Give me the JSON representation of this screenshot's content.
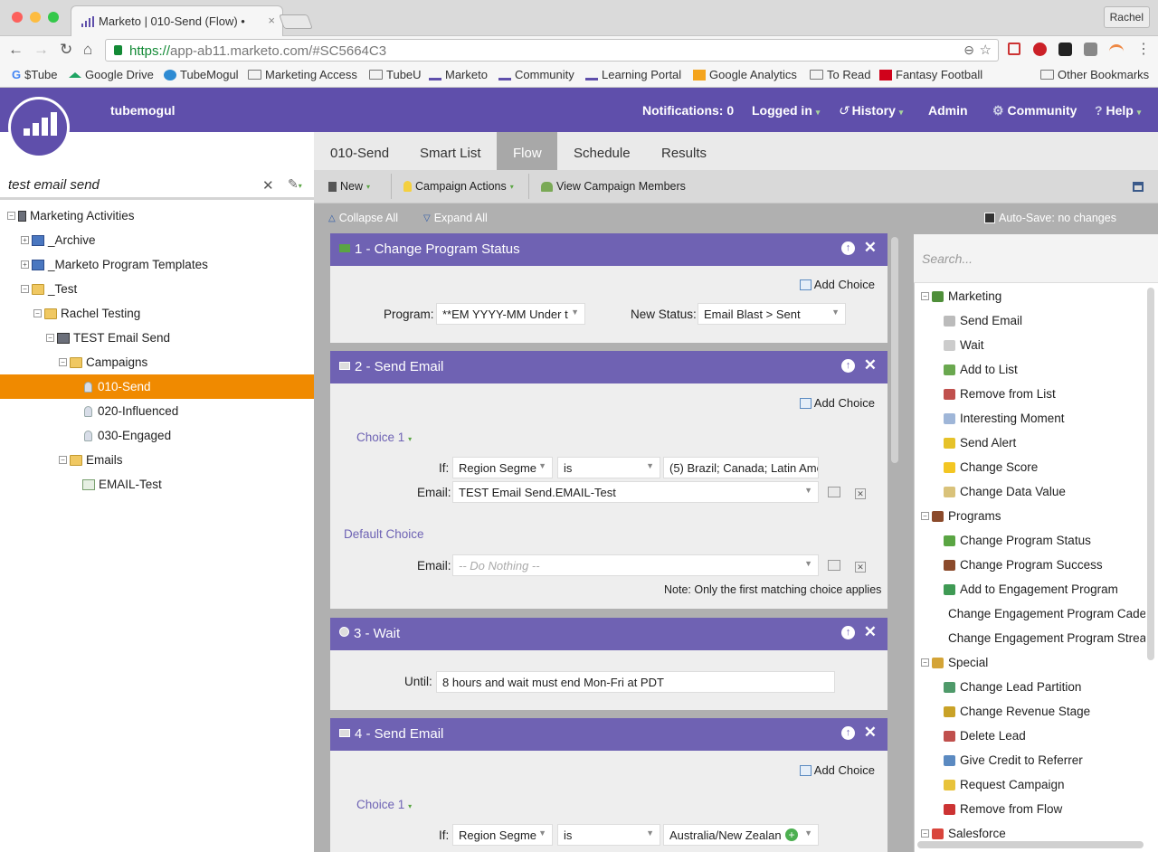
{
  "browser": {
    "tab_title": "Marketo | 010-Send (Flow) •",
    "tab_close": "×",
    "profile": "Rachel",
    "url_https": "https://",
    "url_rest": "app-ab11.marketo.com/#SC5664C3",
    "bookmarks": [
      "$Tube",
      "Google Drive",
      "TubeMogul",
      "Marketing Access",
      "TubeU",
      "Marketo",
      "Community",
      "Learning Portal",
      "Google Analytics",
      "To Read",
      "Fantasy Football"
    ],
    "other_bookmarks": "Other Bookmarks"
  },
  "header": {
    "workspace": "tubemogul",
    "notifications": "Notifications: 0",
    "logged_in": "Logged in",
    "history": "History",
    "admin": "Admin",
    "community": "Community",
    "help": "Help"
  },
  "left": {
    "search_value": "test email send",
    "clear": "✕",
    "tree": [
      {
        "label": "Marketing Activities"
      },
      {
        "label": "_Archive"
      },
      {
        "label": "_Marketo Program Templates"
      },
      {
        "label": "_Test"
      },
      {
        "label": "Rachel Testing"
      },
      {
        "label": "TEST Email Send"
      },
      {
        "label": "Campaigns"
      },
      {
        "label": "010-Send"
      },
      {
        "label": "020-Influenced"
      },
      {
        "label": "030-Engaged"
      },
      {
        "label": "Emails"
      },
      {
        "label": "EMAIL-Test"
      }
    ]
  },
  "tabs": [
    "010-Send",
    "Smart List",
    "Flow",
    "Schedule",
    "Results"
  ],
  "actions": {
    "new": "New",
    "campaign_actions": "Campaign Actions",
    "view_members": "View Campaign Members",
    "collapse_all": "Collapse All",
    "expand_all": "Expand All",
    "autosave": "Auto-Save: no changes"
  },
  "flow": {
    "add_choice": "Add Choice",
    "step1": {
      "title": "1 - Change Program Status",
      "program_label": "Program:",
      "program_value": "**EM YYYY-MM Under t",
      "status_label": "New Status:",
      "status_value": "Email Blast > Sent"
    },
    "step2": {
      "title": "2 - Send Email",
      "choice1": "Choice 1",
      "if_label": "If:",
      "if_field": "Region Segme",
      "if_op": "is",
      "if_value": "(5) Brazil; Canada; Latin Ame",
      "email_label": "Email:",
      "email_value": "TEST Email Send.EMAIL-Test",
      "default_choice": "Default Choice",
      "default_email_label": "Email:",
      "default_email_value": "-- Do Nothing --",
      "note": "Note: Only the first matching choice applies"
    },
    "step3": {
      "title": "3 - Wait",
      "until_label": "Until:",
      "until_value": "8 hours and wait must end Mon-Fri at  PDT"
    },
    "step4": {
      "title": "4 - Send Email",
      "choice1": "Choice 1",
      "if_label": "If:",
      "if_field": "Region Segme",
      "if_op": "is",
      "if_value": "Australia/New Zealan"
    }
  },
  "right": {
    "search_placeholder": "Search...",
    "items": [
      {
        "label": "Marketing",
        "group": true,
        "color": "#4f8f3a"
      },
      {
        "label": "Send Email",
        "color": "#bbbbbb"
      },
      {
        "label": "Wait",
        "color": "#cccccc"
      },
      {
        "label": "Add to List",
        "color": "#6aa84f"
      },
      {
        "label": "Remove from List",
        "color": "#c0504d"
      },
      {
        "label": "Interesting Moment",
        "color": "#9fb6d8"
      },
      {
        "label": "Send Alert",
        "color": "#e6c229"
      },
      {
        "label": "Change Score",
        "color": "#f3c623"
      },
      {
        "label": "Change Data Value",
        "color": "#d9c27a"
      },
      {
        "label": "Programs",
        "group": true,
        "color": "#8b4a2b"
      },
      {
        "label": "Change Program Status",
        "color": "#5aa543"
      },
      {
        "label": "Change Program Success",
        "color": "#8b4a2b"
      },
      {
        "label": "Add to Engagement Program",
        "color": "#3f9a54"
      },
      {
        "label": "Change Engagement Program Cade",
        "color": "#3f9a54"
      },
      {
        "label": "Change Engagement Program Strea",
        "color": "#3f9a54"
      },
      {
        "label": "Special",
        "group": true,
        "color": "#d4a437"
      },
      {
        "label": "Change Lead Partition",
        "color": "#4f9a6a"
      },
      {
        "label": "Change Revenue Stage",
        "color": "#c9a227"
      },
      {
        "label": "Delete Lead",
        "color": "#c0504d"
      },
      {
        "label": "Give Credit to Referrer",
        "color": "#5b8ac1"
      },
      {
        "label": "Request Campaign",
        "color": "#e8c33b"
      },
      {
        "label": "Remove from Flow",
        "color": "#cc3333"
      },
      {
        "label": "Salesforce",
        "group": true,
        "color": "#d9453c"
      }
    ]
  }
}
